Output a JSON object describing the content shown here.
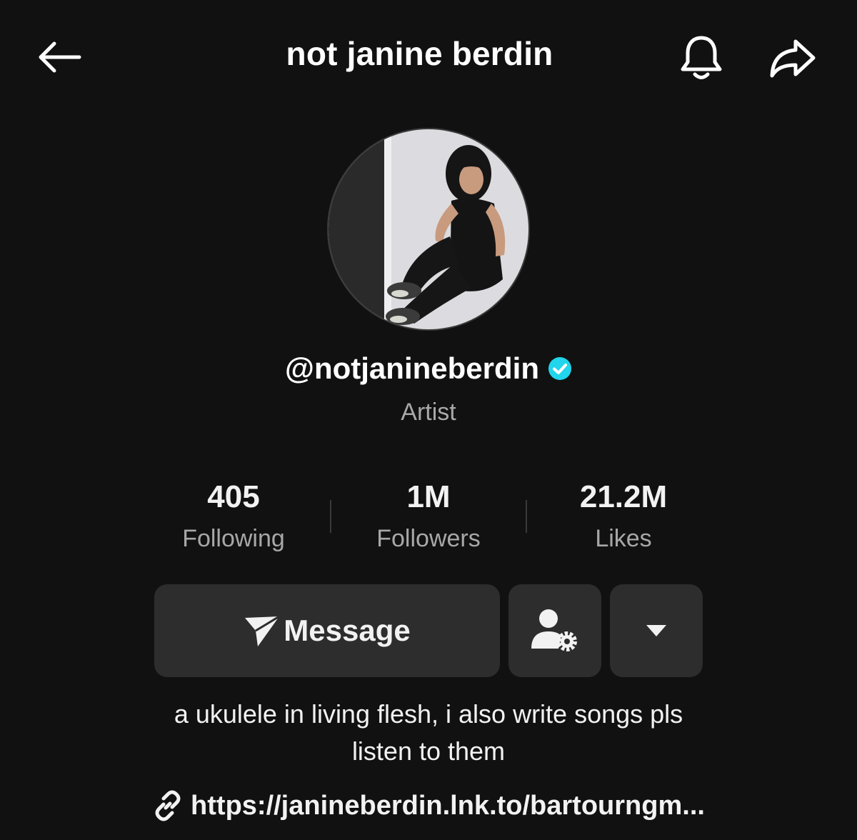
{
  "header": {
    "title": "not janine berdin",
    "back_icon": "arrow-left-icon",
    "bell_icon": "bell-icon",
    "share_icon": "share-arrow-icon"
  },
  "profile": {
    "avatar": "profile-photo",
    "username": "@notjanineberdin",
    "verified_icon": "verified-check-icon",
    "category": "Artist"
  },
  "stats": [
    {
      "value": "405",
      "label": "Following"
    },
    {
      "value": "1M",
      "label": "Followers"
    },
    {
      "value": "21.2M",
      "label": "Likes"
    }
  ],
  "actions": {
    "message_label": "Message",
    "message_icon": "send-arrow-icon",
    "friends_icon": "user-settings-icon",
    "more_icon": "caret-down-icon"
  },
  "bio": {
    "line1": "a ukulele in living flesh, i also write songs pls",
    "line2": "listen to them"
  },
  "link": {
    "icon": "link-icon",
    "text": "https://janineberdin.lnk.to/bartourngm..."
  },
  "colors": {
    "background": "#111111",
    "button_bg": "#2d2d2d",
    "muted_text": "#a8a8a8",
    "verified": "#20d5ec"
  }
}
